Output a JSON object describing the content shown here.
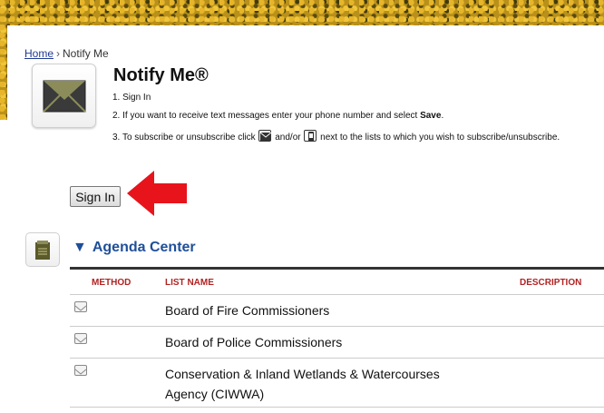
{
  "breadcrumb": {
    "home": "Home",
    "separator": "›",
    "current": "Notify Me"
  },
  "page": {
    "title": "Notify Me®"
  },
  "steps": {
    "s1": "1. Sign In",
    "s2_pre": "2. If you want to receive text messages enter your phone number and select ",
    "s2_bold": "Save",
    "s2_post": ".",
    "s3_pre": "3. To subscribe or unsubscribe click ",
    "s3_mid": " and/or ",
    "s3_post": " next to the lists to which you wish to subscribe/unsubscribe."
  },
  "signin": {
    "label": "Sign In"
  },
  "section": {
    "title": "Agenda Center",
    "toggle": "▼"
  },
  "table": {
    "headers": {
      "method": "METHOD",
      "list_name": "LIST NAME",
      "description": "DESCRIPTION"
    },
    "rows": [
      {
        "name": "Board of Fire Commissioners"
      },
      {
        "name": "Board of Police Commissioners"
      },
      {
        "name_line1": "Conservation & Inland Wetlands & Watercourses",
        "name_line2": "Agency (CIWWA)"
      }
    ]
  },
  "icons": {
    "mail": "envelope-icon",
    "sms": "phone-icon",
    "agenda": "notepad-icon",
    "arrow": "red-arrow-icon"
  },
  "colors": {
    "link": "#1f3a93",
    "section": "#1f4f99",
    "header_red": "#b22222",
    "arrow": "#e8141c"
  }
}
